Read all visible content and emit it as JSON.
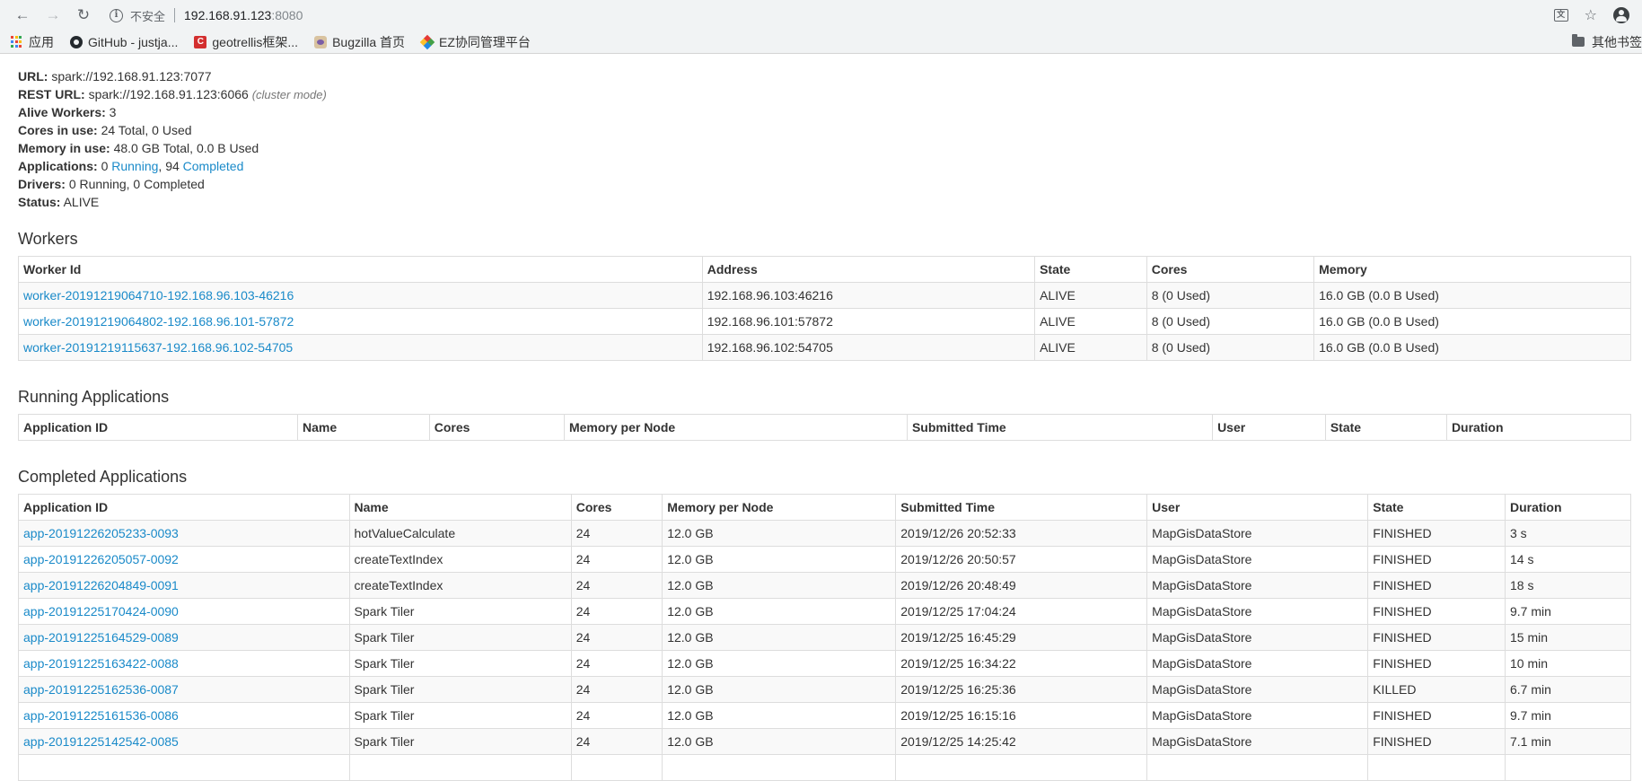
{
  "browser": {
    "insecure_label": "不安全",
    "url_host": "192.168.91.123",
    "url_port": ":8080",
    "bookmarks": [
      {
        "label": "应用",
        "icon": "apps-grid-icon"
      },
      {
        "label": "GitHub - justja...",
        "icon": "github-icon"
      },
      {
        "label": "geotrellis框架...",
        "icon": "geotrellis-icon"
      },
      {
        "label": "Bugzilla 首页",
        "icon": "bugzilla-icon"
      },
      {
        "label": "EZ协同管理平台",
        "icon": "ez-icon"
      }
    ],
    "other_bookmarks": "其他书签"
  },
  "summary": {
    "url_label": "URL:",
    "url_value": "spark://192.168.91.123:7077",
    "rest_label": "REST URL:",
    "rest_value": "spark://192.168.91.123:6066",
    "rest_mode": "(cluster mode)",
    "alive_label": "Alive Workers:",
    "alive_value": "3",
    "cores_label": "Cores in use:",
    "cores_value": "24 Total, 0 Used",
    "memory_label": "Memory in use:",
    "memory_value": "48.0 GB Total, 0.0 B Used",
    "apps_label": "Applications:",
    "apps_running_count": "0",
    "apps_running_link": "Running",
    "apps_sep": ",",
    "apps_completed_count": "94",
    "apps_completed_link": "Completed",
    "drivers_label": "Drivers:",
    "drivers_value": "0 Running, 0 Completed",
    "status_label": "Status:",
    "status_value": "ALIVE"
  },
  "workers": {
    "title": "Workers",
    "headers": [
      "Worker Id",
      "Address",
      "State",
      "Cores",
      "Memory"
    ],
    "rows": [
      [
        "worker-20191219064710-192.168.96.103-46216",
        "192.168.96.103:46216",
        "ALIVE",
        "8 (0 Used)",
        "16.0 GB (0.0 B Used)"
      ],
      [
        "worker-20191219064802-192.168.96.101-57872",
        "192.168.96.101:57872",
        "ALIVE",
        "8 (0 Used)",
        "16.0 GB (0.0 B Used)"
      ],
      [
        "worker-20191219115637-192.168.96.102-54705",
        "192.168.96.102:54705",
        "ALIVE",
        "8 (0 Used)",
        "16.0 GB (0.0 B Used)"
      ]
    ]
  },
  "running": {
    "title": "Running Applications",
    "headers": [
      "Application ID",
      "Name",
      "Cores",
      "Memory per Node",
      "Submitted Time",
      "User",
      "State",
      "Duration"
    ]
  },
  "completed": {
    "title": "Completed Applications",
    "headers": [
      "Application ID",
      "Name",
      "Cores",
      "Memory per Node",
      "Submitted Time",
      "User",
      "State",
      "Duration"
    ],
    "rows": [
      [
        "app-20191226205233-0093",
        "hotValueCalculate",
        "24",
        "12.0 GB",
        "2019/12/26 20:52:33",
        "MapGisDataStore",
        "FINISHED",
        "3 s"
      ],
      [
        "app-20191226205057-0092",
        "createTextIndex",
        "24",
        "12.0 GB",
        "2019/12/26 20:50:57",
        "MapGisDataStore",
        "FINISHED",
        "14 s"
      ],
      [
        "app-20191226204849-0091",
        "createTextIndex",
        "24",
        "12.0 GB",
        "2019/12/26 20:48:49",
        "MapGisDataStore",
        "FINISHED",
        "18 s"
      ],
      [
        "app-20191225170424-0090",
        "Spark Tiler",
        "24",
        "12.0 GB",
        "2019/12/25 17:04:24",
        "MapGisDataStore",
        "FINISHED",
        "9.7 min"
      ],
      [
        "app-20191225164529-0089",
        "Spark Tiler",
        "24",
        "12.0 GB",
        "2019/12/25 16:45:29",
        "MapGisDataStore",
        "FINISHED",
        "15 min"
      ],
      [
        "app-20191225163422-0088",
        "Spark Tiler",
        "24",
        "12.0 GB",
        "2019/12/25 16:34:22",
        "MapGisDataStore",
        "FINISHED",
        "10 min"
      ],
      [
        "app-20191225162536-0087",
        "Spark Tiler",
        "24",
        "12.0 GB",
        "2019/12/25 16:25:36",
        "MapGisDataStore",
        "KILLED",
        "6.7 min"
      ],
      [
        "app-20191225161536-0086",
        "Spark Tiler",
        "24",
        "12.0 GB",
        "2019/12/25 16:15:16",
        "MapGisDataStore",
        "FINISHED",
        "9.7 min"
      ],
      [
        "app-20191225142542-0085",
        "Spark Tiler",
        "24",
        "12.0 GB",
        "2019/12/25 14:25:42",
        "MapGisDataStore",
        "FINISHED",
        "7.1 min"
      ],
      [
        "",
        "",
        "",
        "",
        "",
        "",
        "",
        ""
      ]
    ]
  },
  "colors": {
    "link": "#1a8ac9",
    "border": "#dddddd",
    "stripe": "#f9f9f9"
  }
}
